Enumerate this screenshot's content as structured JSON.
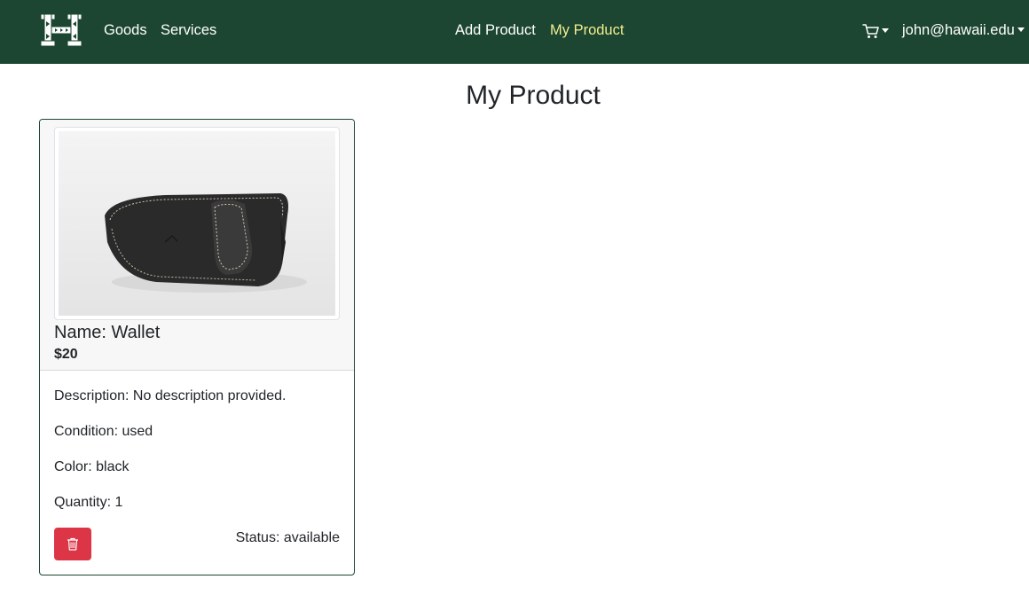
{
  "nav": {
    "goods": "Goods",
    "services": "Services",
    "add_product": "Add Product",
    "my_product": "My Product",
    "user_email": "john@hawaii.edu",
    "logo_icon": "hawaii-h-logo-icon",
    "cart_icon": "shopping-cart-icon",
    "active_color": "#f3ee8f",
    "bg_color": "#1c4631"
  },
  "page": {
    "title": "My Product"
  },
  "product": {
    "image_icon": "wallet-image",
    "name_text": "Name: Wallet",
    "price": "$20",
    "description_text": "Description: No description provided.",
    "condition_text": "Condition: used",
    "color_text": "Color: black",
    "quantity_text": "Quantity: 1",
    "status_text": "Status: available",
    "delete_icon": "trash-icon",
    "delete_color": "#dc3545"
  }
}
